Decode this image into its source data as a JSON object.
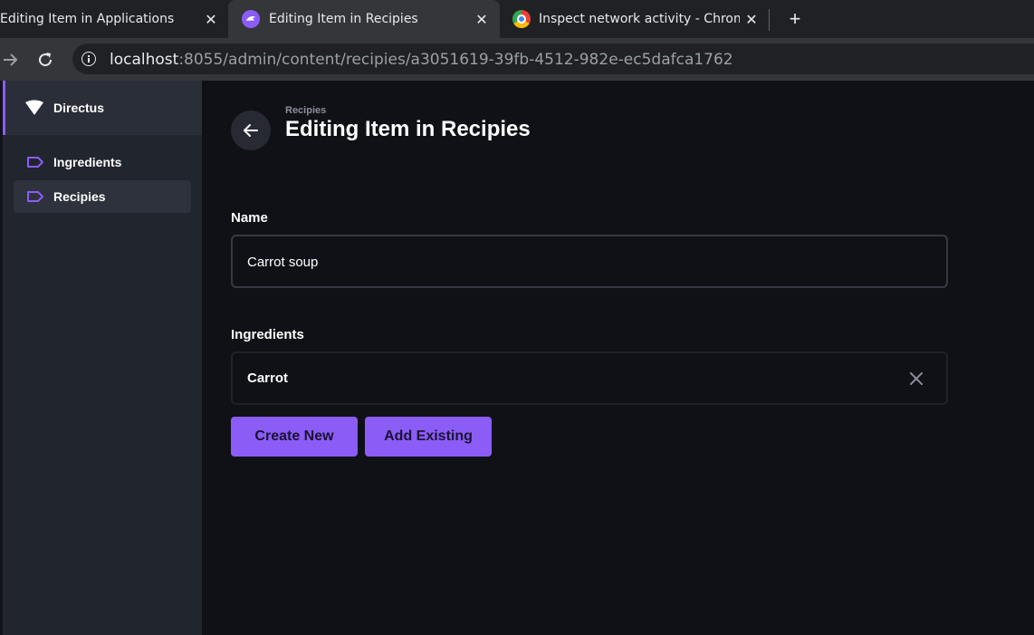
{
  "browser": {
    "tabs": [
      {
        "title": "Editing Item in Applications"
      },
      {
        "title": "Editing Item in Recipies"
      },
      {
        "title": "Inspect network activity - Chrome"
      }
    ],
    "url_host": "localhost",
    "url_path": ":8055/admin/content/recipies/a3051619-39fb-4512-982e-ec5dafca1762"
  },
  "sidebar": {
    "project_name": "Directus",
    "items": [
      {
        "label": "Ingredients",
        "active": false
      },
      {
        "label": "Recipies",
        "active": true
      }
    ]
  },
  "header": {
    "breadcrumb": "Recipies",
    "title": "Editing Item in Recipies"
  },
  "form": {
    "name_label": "Name",
    "name_value": "Carrot soup",
    "ingredients_label": "Ingredients",
    "ingredients": [
      "Carrot"
    ],
    "create_new_label": "Create New",
    "add_existing_label": "Add Existing"
  },
  "colors": {
    "accent": "#8b5cf6",
    "sidebar_bg": "#21252e",
    "main_bg": "#0f1117"
  }
}
